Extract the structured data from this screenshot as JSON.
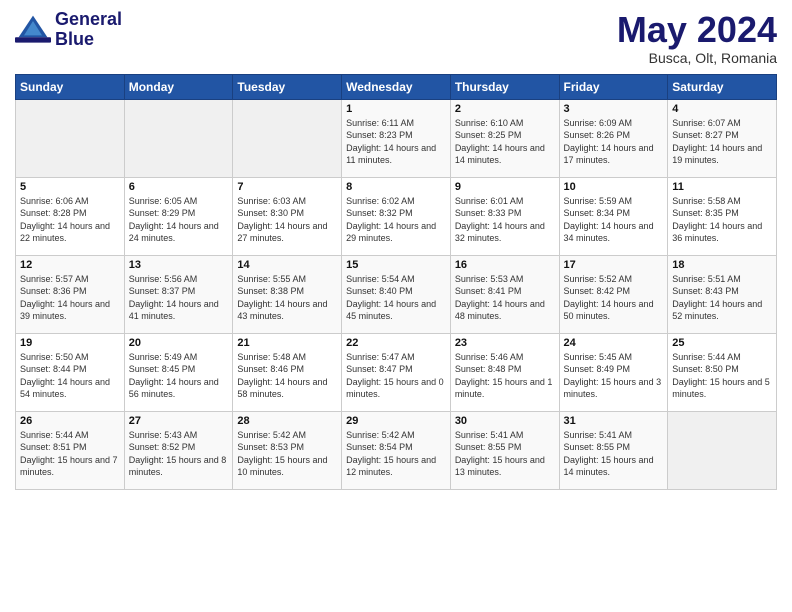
{
  "header": {
    "logo_line1": "General",
    "logo_line2": "Blue",
    "month": "May 2024",
    "location": "Busca, Olt, Romania"
  },
  "days_of_week": [
    "Sunday",
    "Monday",
    "Tuesday",
    "Wednesday",
    "Thursday",
    "Friday",
    "Saturday"
  ],
  "weeks": [
    [
      {
        "day": "",
        "detail": ""
      },
      {
        "day": "",
        "detail": ""
      },
      {
        "day": "",
        "detail": ""
      },
      {
        "day": "1",
        "detail": "Sunrise: 6:11 AM\nSunset: 8:23 PM\nDaylight: 14 hours and 11 minutes."
      },
      {
        "day": "2",
        "detail": "Sunrise: 6:10 AM\nSunset: 8:25 PM\nDaylight: 14 hours and 14 minutes."
      },
      {
        "day": "3",
        "detail": "Sunrise: 6:09 AM\nSunset: 8:26 PM\nDaylight: 14 hours and 17 minutes."
      },
      {
        "day": "4",
        "detail": "Sunrise: 6:07 AM\nSunset: 8:27 PM\nDaylight: 14 hours and 19 minutes."
      }
    ],
    [
      {
        "day": "5",
        "detail": "Sunrise: 6:06 AM\nSunset: 8:28 PM\nDaylight: 14 hours and 22 minutes."
      },
      {
        "day": "6",
        "detail": "Sunrise: 6:05 AM\nSunset: 8:29 PM\nDaylight: 14 hours and 24 minutes."
      },
      {
        "day": "7",
        "detail": "Sunrise: 6:03 AM\nSunset: 8:30 PM\nDaylight: 14 hours and 27 minutes."
      },
      {
        "day": "8",
        "detail": "Sunrise: 6:02 AM\nSunset: 8:32 PM\nDaylight: 14 hours and 29 minutes."
      },
      {
        "day": "9",
        "detail": "Sunrise: 6:01 AM\nSunset: 8:33 PM\nDaylight: 14 hours and 32 minutes."
      },
      {
        "day": "10",
        "detail": "Sunrise: 5:59 AM\nSunset: 8:34 PM\nDaylight: 14 hours and 34 minutes."
      },
      {
        "day": "11",
        "detail": "Sunrise: 5:58 AM\nSunset: 8:35 PM\nDaylight: 14 hours and 36 minutes."
      }
    ],
    [
      {
        "day": "12",
        "detail": "Sunrise: 5:57 AM\nSunset: 8:36 PM\nDaylight: 14 hours and 39 minutes."
      },
      {
        "day": "13",
        "detail": "Sunrise: 5:56 AM\nSunset: 8:37 PM\nDaylight: 14 hours and 41 minutes."
      },
      {
        "day": "14",
        "detail": "Sunrise: 5:55 AM\nSunset: 8:38 PM\nDaylight: 14 hours and 43 minutes."
      },
      {
        "day": "15",
        "detail": "Sunrise: 5:54 AM\nSunset: 8:40 PM\nDaylight: 14 hours and 45 minutes."
      },
      {
        "day": "16",
        "detail": "Sunrise: 5:53 AM\nSunset: 8:41 PM\nDaylight: 14 hours and 48 minutes."
      },
      {
        "day": "17",
        "detail": "Sunrise: 5:52 AM\nSunset: 8:42 PM\nDaylight: 14 hours and 50 minutes."
      },
      {
        "day": "18",
        "detail": "Sunrise: 5:51 AM\nSunset: 8:43 PM\nDaylight: 14 hours and 52 minutes."
      }
    ],
    [
      {
        "day": "19",
        "detail": "Sunrise: 5:50 AM\nSunset: 8:44 PM\nDaylight: 14 hours and 54 minutes."
      },
      {
        "day": "20",
        "detail": "Sunrise: 5:49 AM\nSunset: 8:45 PM\nDaylight: 14 hours and 56 minutes."
      },
      {
        "day": "21",
        "detail": "Sunrise: 5:48 AM\nSunset: 8:46 PM\nDaylight: 14 hours and 58 minutes."
      },
      {
        "day": "22",
        "detail": "Sunrise: 5:47 AM\nSunset: 8:47 PM\nDaylight: 15 hours and 0 minutes."
      },
      {
        "day": "23",
        "detail": "Sunrise: 5:46 AM\nSunset: 8:48 PM\nDaylight: 15 hours and 1 minute."
      },
      {
        "day": "24",
        "detail": "Sunrise: 5:45 AM\nSunset: 8:49 PM\nDaylight: 15 hours and 3 minutes."
      },
      {
        "day": "25",
        "detail": "Sunrise: 5:44 AM\nSunset: 8:50 PM\nDaylight: 15 hours and 5 minutes."
      }
    ],
    [
      {
        "day": "26",
        "detail": "Sunrise: 5:44 AM\nSunset: 8:51 PM\nDaylight: 15 hours and 7 minutes."
      },
      {
        "day": "27",
        "detail": "Sunrise: 5:43 AM\nSunset: 8:52 PM\nDaylight: 15 hours and 8 minutes."
      },
      {
        "day": "28",
        "detail": "Sunrise: 5:42 AM\nSunset: 8:53 PM\nDaylight: 15 hours and 10 minutes."
      },
      {
        "day": "29",
        "detail": "Sunrise: 5:42 AM\nSunset: 8:54 PM\nDaylight: 15 hours and 12 minutes."
      },
      {
        "day": "30",
        "detail": "Sunrise: 5:41 AM\nSunset: 8:55 PM\nDaylight: 15 hours and 13 minutes."
      },
      {
        "day": "31",
        "detail": "Sunrise: 5:41 AM\nSunset: 8:55 PM\nDaylight: 15 hours and 14 minutes."
      },
      {
        "day": "",
        "detail": ""
      }
    ]
  ]
}
